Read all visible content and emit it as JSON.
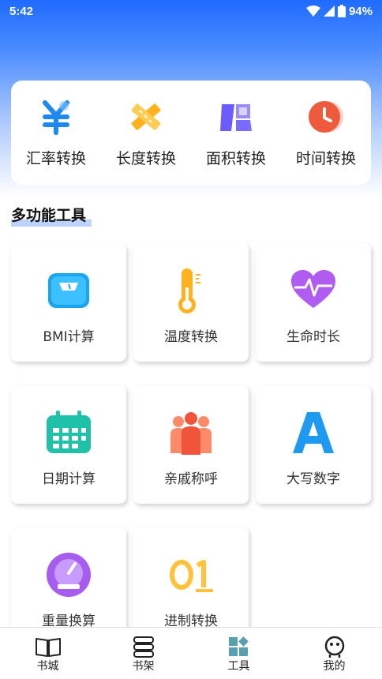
{
  "status": {
    "time": "5:42",
    "battery": "94%"
  },
  "quick_tools": [
    {
      "label": "汇率转换",
      "icon": "yuan-icon"
    },
    {
      "label": "长度转换",
      "icon": "ruler-pencil-icon"
    },
    {
      "label": "面积转换",
      "icon": "area-icon"
    },
    {
      "label": "时间转换",
      "icon": "clock-icon"
    }
  ],
  "section": {
    "title": "多功能工具"
  },
  "tools": [
    {
      "label": "BMI计算",
      "icon": "scale-icon"
    },
    {
      "label": "温度转换",
      "icon": "thermometer-icon"
    },
    {
      "label": "生命时长",
      "icon": "heart-pulse-icon"
    },
    {
      "label": "日期计算",
      "icon": "calendar-icon"
    },
    {
      "label": "亲戚称呼",
      "icon": "family-icon"
    },
    {
      "label": "大写数字",
      "icon": "letter-a-icon"
    },
    {
      "label": "重量换算",
      "icon": "weight-gauge-icon"
    },
    {
      "label": "进制转换",
      "icon": "binary-icon"
    }
  ],
  "tabs": [
    {
      "label": "书城",
      "icon": "book-icon"
    },
    {
      "label": "书架",
      "icon": "bookshelf-icon"
    },
    {
      "label": "工具",
      "icon": "tools-grid-icon"
    },
    {
      "label": "我的",
      "icon": "profile-face-icon"
    }
  ],
  "colors": {
    "accent": "#1f6bff",
    "tab_active": "#5a9fb0"
  }
}
